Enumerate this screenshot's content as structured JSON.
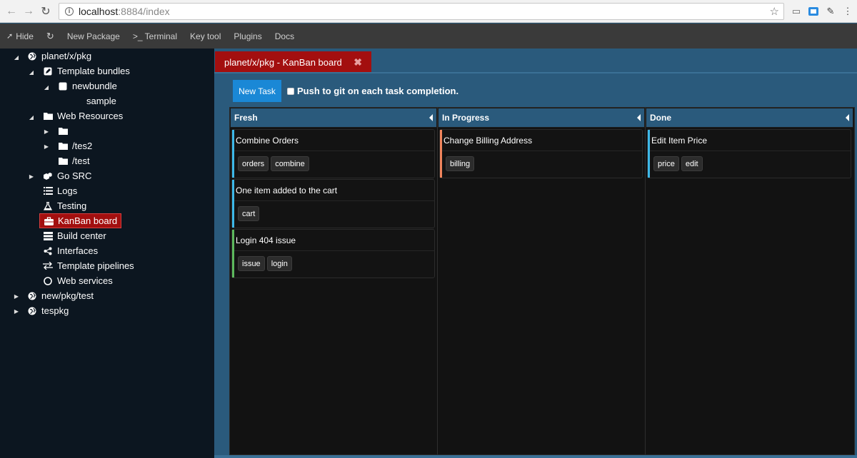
{
  "browser": {
    "url_host": "localhost",
    "url_path": ":8884/index"
  },
  "toolbar": {
    "items": [
      {
        "label": "Hide",
        "icon": "pin-icon"
      },
      {
        "label": "",
        "icon": "refresh-icon"
      },
      {
        "label": "New Package",
        "icon": ""
      },
      {
        "label": ">_ Terminal",
        "icon": ""
      },
      {
        "label": "Key tool",
        "icon": ""
      },
      {
        "label": "Plugins",
        "icon": ""
      },
      {
        "label": "Docs",
        "icon": ""
      }
    ]
  },
  "sidebar": {
    "items": [
      {
        "label": "planet/x/pkg",
        "icon": "globe-icon",
        "toggle": "expanded"
      },
      {
        "label": "Template bundles",
        "icon": "edit-icon",
        "toggle": "expanded"
      },
      {
        "label": "newbundle",
        "icon": "square-icon",
        "toggle": "expanded"
      },
      {
        "label": "sample",
        "icon": "",
        "toggle": ""
      },
      {
        "label": "Web Resources",
        "icon": "folder-icon",
        "toggle": "expanded"
      },
      {
        "label": "",
        "icon": "folder-icon",
        "toggle": "collapsed"
      },
      {
        "label": "/tes2",
        "icon": "folder-icon",
        "toggle": "collapsed"
      },
      {
        "label": "/test",
        "icon": "folder-icon",
        "toggle": ""
      },
      {
        "label": "Go SRC",
        "icon": "cubes-icon",
        "toggle": "collapsed"
      },
      {
        "label": "Logs",
        "icon": "list-icon",
        "toggle": ""
      },
      {
        "label": "Testing",
        "icon": "flask-icon",
        "toggle": ""
      },
      {
        "label": "KanBan board",
        "icon": "briefcase-icon",
        "toggle": "",
        "selected": true
      },
      {
        "label": "Build center",
        "icon": "server-icon",
        "toggle": ""
      },
      {
        "label": "Interfaces",
        "icon": "share-icon",
        "toggle": ""
      },
      {
        "label": "Template pipelines",
        "icon": "exchange-icon",
        "toggle": ""
      },
      {
        "label": "Web services",
        "icon": "circle-icon",
        "toggle": ""
      },
      {
        "label": "new/pkg/test",
        "icon": "globe-icon",
        "toggle": "collapsed"
      },
      {
        "label": "tespkg",
        "icon": "globe-icon",
        "toggle": "collapsed"
      }
    ]
  },
  "tab": {
    "label": "planet/x/pkg - KanBan board",
    "close": "✖"
  },
  "actions": {
    "new_task_label": "New Task",
    "push_label": "Push to git on each task completion.",
    "push_checked": false
  },
  "board": {
    "columns": [
      {
        "title": "Fresh",
        "cards": [
          {
            "title": "Combine Orders",
            "color": "#3db8e8",
            "tags": [
              "orders",
              "combine"
            ]
          },
          {
            "title": "One item added to the cart",
            "color": "#3db8e8",
            "tags": [
              "cart"
            ]
          },
          {
            "title": "Login 404 issue",
            "color": "#5cb85c",
            "tags": [
              "issue",
              "login"
            ]
          }
        ]
      },
      {
        "title": "In Progress",
        "cards": [
          {
            "title": "Change Billing Address",
            "color": "#f0845c",
            "tags": [
              "billing"
            ]
          }
        ]
      },
      {
        "title": "Done",
        "cards": [
          {
            "title": "Edit Item Price",
            "color": "#3db8e8",
            "tags": [
              "price",
              "edit"
            ]
          }
        ]
      }
    ]
  }
}
